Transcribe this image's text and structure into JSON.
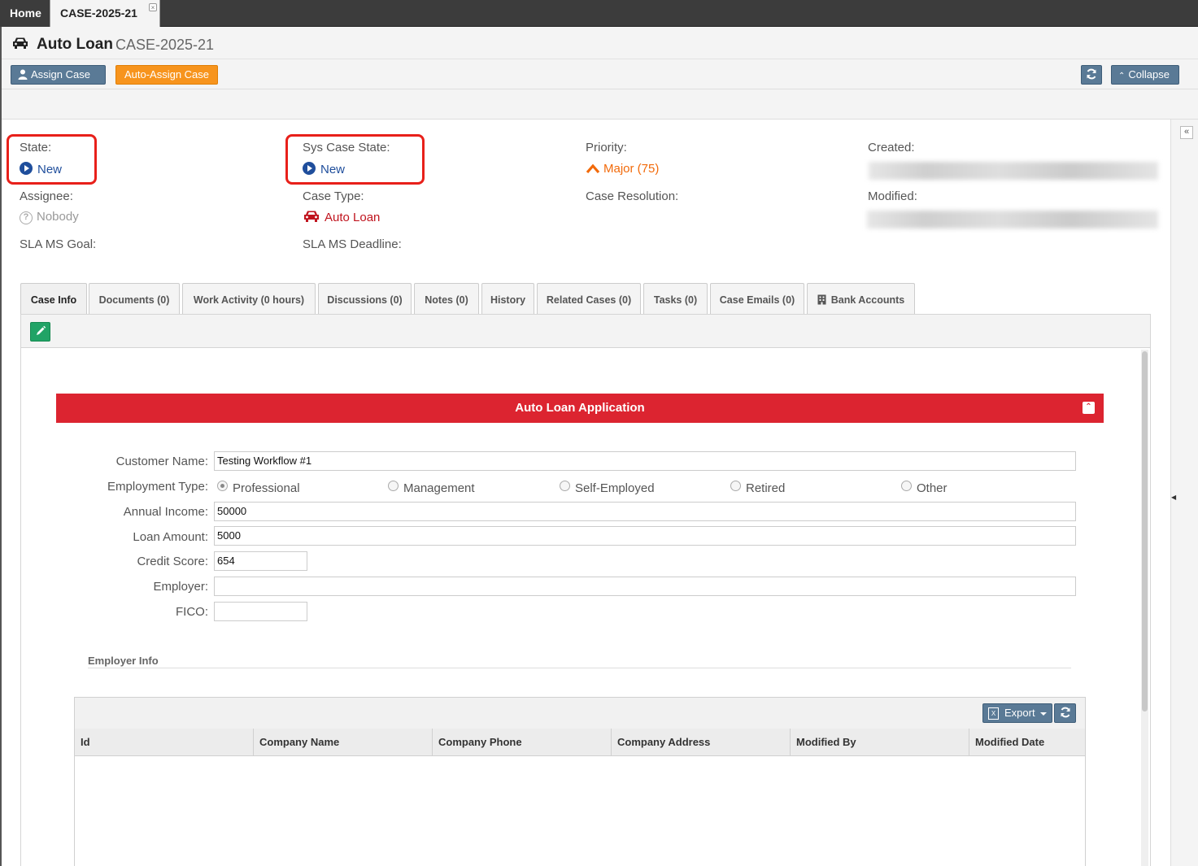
{
  "top_tabs": {
    "home": "Home",
    "case": "CASE-2025-21",
    "close": "×"
  },
  "header": {
    "title": "Auto Loan",
    "case_id": "CASE-2025-21"
  },
  "toolbar": {
    "assign_case": "Assign Case",
    "auto_assign": "Auto-Assign Case",
    "collapse": "Collapse"
  },
  "summary": {
    "state_label": "State:",
    "state_value": "New",
    "sys_state_label": "Sys Case State:",
    "sys_state_value": "New",
    "priority_label": "Priority:",
    "priority_value": "Major (75)",
    "created_label": "Created:",
    "assignee_label": "Assignee:",
    "assignee_value": "Nobody",
    "case_type_label": "Case Type:",
    "case_type_value": "Auto Loan",
    "resolution_label": "Case Resolution:",
    "modified_label": "Modified:",
    "sla_goal_label": "SLA MS Goal:",
    "sla_deadline_label": "SLA MS Deadline:"
  },
  "tabs": [
    "Case Info",
    "Documents (0)",
    "Work Activity (0 hours)",
    "Discussions (0)",
    "Notes (0)",
    "History",
    "Related Cases (0)",
    "Tasks (0)",
    "Case Emails (0)",
    "Bank Accounts"
  ],
  "form": {
    "section_title": "Auto Loan Application",
    "customer_name_label": "Customer Name:",
    "customer_name": "Testing Workflow #1",
    "employment_type_label": "Employment Type:",
    "employment_options": [
      "Professional",
      "Management",
      "Self-Employed",
      "Retired",
      "Other"
    ],
    "employment_selected": "Professional",
    "annual_income_label": "Annual Income:",
    "annual_income": "50000",
    "loan_amount_label": "Loan Amount:",
    "loan_amount": "5000",
    "credit_score_label": "Credit Score:",
    "credit_score": "654",
    "employer_label": "Employer:",
    "employer": "",
    "fico_label": "FICO:",
    "fico": ""
  },
  "employer_info": {
    "title": "Employer Info",
    "export": "Export",
    "columns": [
      "Id",
      "Company Name",
      "Company Phone",
      "Company Address",
      "Modified By",
      "Modified Date"
    ]
  },
  "colors": {
    "section_red": "#dc2430",
    "button_blue": "#5a7a96",
    "auto_assign_orange": "#f7941d",
    "edit_green": "#21a366",
    "highlight": "#e8201a",
    "link_blue": "#1f4e9c",
    "priority_orange": "#f26a0a"
  }
}
